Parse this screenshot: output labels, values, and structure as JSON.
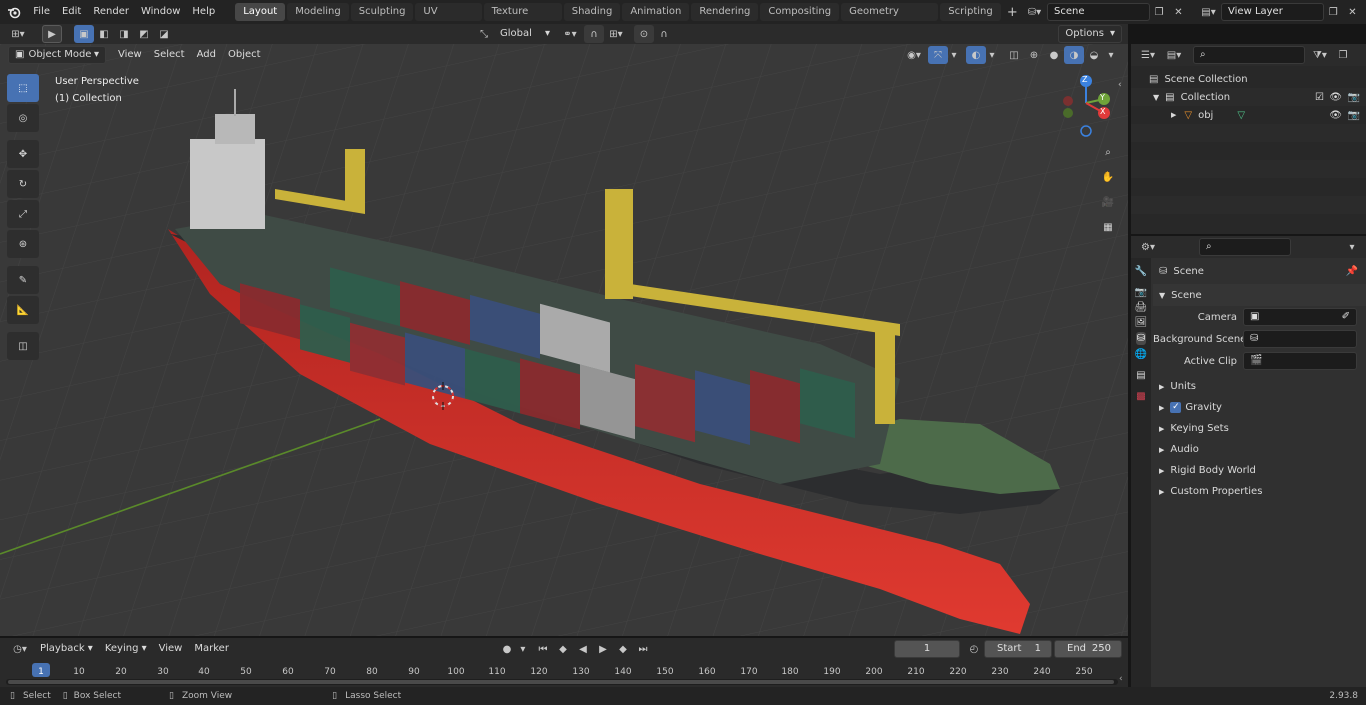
{
  "app": {
    "version": "2.93.8"
  },
  "menu": [
    "File",
    "Edit",
    "Render",
    "Window",
    "Help"
  ],
  "workspaces": [
    "Layout",
    "Modeling",
    "Sculpting",
    "UV Editing",
    "Texture Paint",
    "Shading",
    "Animation",
    "Rendering",
    "Compositing",
    "Geometry Nodes",
    "Scripting"
  ],
  "scene_selector": {
    "value": "Scene"
  },
  "viewlayer_selector": {
    "value": "View Layer"
  },
  "viewport": {
    "mode": "Object Mode",
    "menus": [
      "View",
      "Select",
      "Add",
      "Object"
    ],
    "transform_orientation": "Global",
    "options_label": "Options",
    "perspective_label": "User Perspective",
    "collection_label": "(1) Collection",
    "gizmo_axes": {
      "x": "X",
      "y": "Y",
      "z": "Z"
    }
  },
  "outliner": {
    "search_placeholder": "",
    "root": "Scene Collection",
    "collection": "Collection",
    "object": "obj"
  },
  "properties": {
    "search_placeholder": "",
    "context_title": "Scene",
    "panel_title": "Scene",
    "fields": [
      {
        "label": "Camera",
        "value": ""
      },
      {
        "label": "Background Scene",
        "value": ""
      },
      {
        "label": "Active Clip",
        "value": ""
      }
    ],
    "sub_panels": [
      "Units",
      "Gravity",
      "Keying Sets",
      "Audio",
      "Rigid Body World",
      "Custom Properties"
    ],
    "gravity_checked": true
  },
  "timeline": {
    "menus": [
      "Playback",
      "Keying",
      "View",
      "Marker"
    ],
    "current_frame": "1",
    "start_label": "Start",
    "start_value": "1",
    "end_label": "End",
    "end_value": "250",
    "ruler": [
      "1",
      "10",
      "20",
      "30",
      "40",
      "50",
      "60",
      "70",
      "80",
      "90",
      "100",
      "110",
      "120",
      "130",
      "140",
      "150",
      "160",
      "170",
      "180",
      "190",
      "200",
      "210",
      "220",
      "230",
      "240",
      "250"
    ]
  },
  "status": {
    "items": [
      "Select",
      "Box Select",
      "Zoom View",
      "Lasso Select"
    ]
  },
  "colors": {
    "accent": "#4772b3",
    "grid_green": "#5a8a2a",
    "hull_red": "#d42a24",
    "crane_yellow": "#c9b23a"
  }
}
